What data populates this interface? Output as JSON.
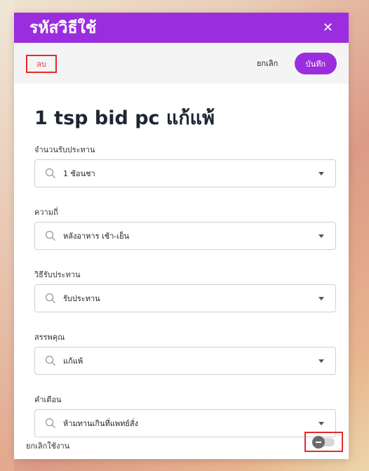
{
  "header": {
    "title": "รหัสวิธีใช้",
    "close_icon": "close-icon",
    "close_glyph": "✕"
  },
  "actions": {
    "delete_label": "ลบ",
    "cancel_label": "ยกเลิก",
    "save_label": "บันทึก"
  },
  "medication": {
    "title": "1 tsp bid pc แก้แพ้"
  },
  "fields": [
    {
      "label": "จำนวนรับประทาน",
      "value": "1 ช้อนชา"
    },
    {
      "label": "ความถี่",
      "value": "หลังอาหาร เช้า-เย็น"
    },
    {
      "label": "วิธีรับประทาน",
      "value": "รับประทาน"
    },
    {
      "label": "สรรพคุณ",
      "value": "แก้แพ้"
    },
    {
      "label": "คำเตือน",
      "value": "ห้ามทานเกินที่แพทย์สั่ง"
    }
  ],
  "disable_toggle": {
    "label": "ยกเลิกใช้งาน",
    "enabled": false
  },
  "colors": {
    "accent": "#9b2dde",
    "highlight_frame": "#e32b2b"
  }
}
